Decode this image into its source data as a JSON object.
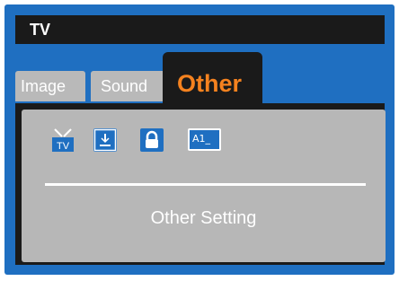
{
  "window": {
    "title": "TV"
  },
  "tabs": [
    {
      "label": "Image"
    },
    {
      "label": "Sound"
    },
    {
      "label": "Other"
    }
  ],
  "icons": [
    {
      "name": "tv-icon",
      "label": "TV"
    },
    {
      "name": "download-icon"
    },
    {
      "name": "lock-icon"
    },
    {
      "name": "subtitle-icon",
      "label": "A1_"
    }
  ],
  "panel": {
    "setting_label": "Other Setting"
  },
  "colors": {
    "frame": "#1f6fc1",
    "title_bar": "#1a1a1a",
    "active_tab_text": "#f5821f",
    "inactive_tab": "#b9b9b9",
    "panel_bg": "#b7b7b7"
  }
}
